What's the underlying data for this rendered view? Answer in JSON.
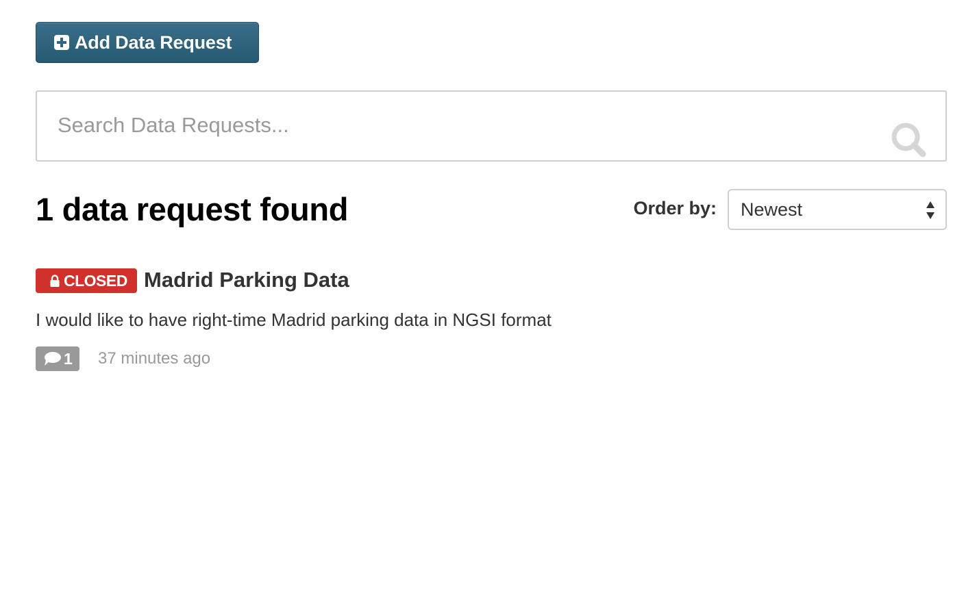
{
  "toolbar": {
    "add_label": "Add Data Request",
    "add_icon": "plus-square-icon"
  },
  "search": {
    "placeholder": "Search Data Requests...",
    "value": "",
    "icon": "search-icon"
  },
  "results": {
    "title": "1 data request found"
  },
  "order": {
    "label": "Order by:",
    "selected": "Newest",
    "icon": "select-arrows-icon"
  },
  "requests": [
    {
      "status": "CLOSED",
      "status_icon": "lock-icon",
      "status_color": "#d0312d",
      "title": "Madrid Parking Data",
      "description": "I would like to have right-time Madrid parking data in NGSI format",
      "comments": "1",
      "comment_icon": "comment-icon",
      "time": "37 minutes ago"
    }
  ],
  "colors": {
    "primary": "#2f6580",
    "closed": "#d0312d",
    "muted": "#999999"
  }
}
